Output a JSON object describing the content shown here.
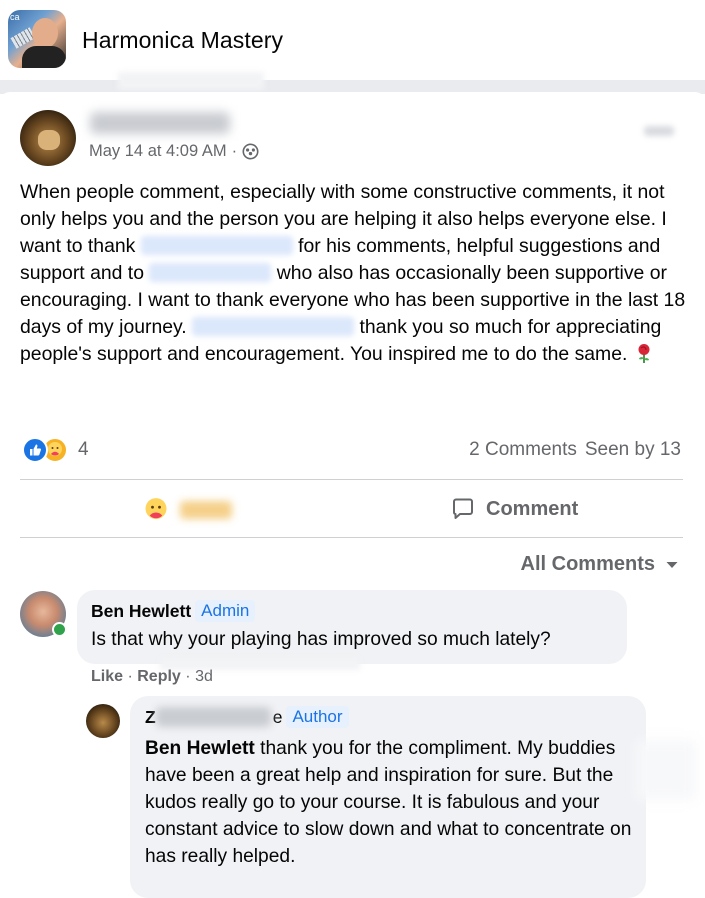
{
  "header": {
    "group_title": "Harmonica Mastery",
    "avatar_tag": "ca"
  },
  "post": {
    "timestamp": "May 14 at 4:09 AM",
    "audience_icon": "group-members-icon",
    "text": {
      "p1": "When people comment, especially with some constructive comments, it not only helps you and the person you are helping it also helps everyone else.  I want to thank ",
      "p2": " for his comments, helpful suggestions and support and to ",
      "p3": " who also has occasionally been supportive or encouraging.  I want to thank everyone who has been supportive in the last 18 days of my journey.  ",
      "p4": " thank you so much for appreciating people's support and encouragement.  You inspired me to do the same. "
    },
    "reaction_count": "4",
    "comments_count": "2 Comments",
    "seen_by": "Seen by 13",
    "comment_button_label": "Comment",
    "sort_label": "All Comments"
  },
  "comments": [
    {
      "author": "Ben Hewlett",
      "badge": "Admin",
      "text": "Is that why your playing has improved so much lately?",
      "like_label": "Like",
      "reply_label": "Reply",
      "age": "3d"
    },
    {
      "author_visible": "Z",
      "author_tail": "e",
      "badge": "Author",
      "mention": "Ben Hewlett",
      "text": " thank you for the compliment. My buddies have been a great help and inspiration for sure. But the kudos really go to your course. It is fabulous and your constant advice to slow down and what to concentrate on has really helped."
    }
  ],
  "colors": {
    "accent_blue": "#1b74e4",
    "secondary_text": "#65676b",
    "bubble_bg": "#f0f2f5",
    "online_green": "#31a24c"
  }
}
